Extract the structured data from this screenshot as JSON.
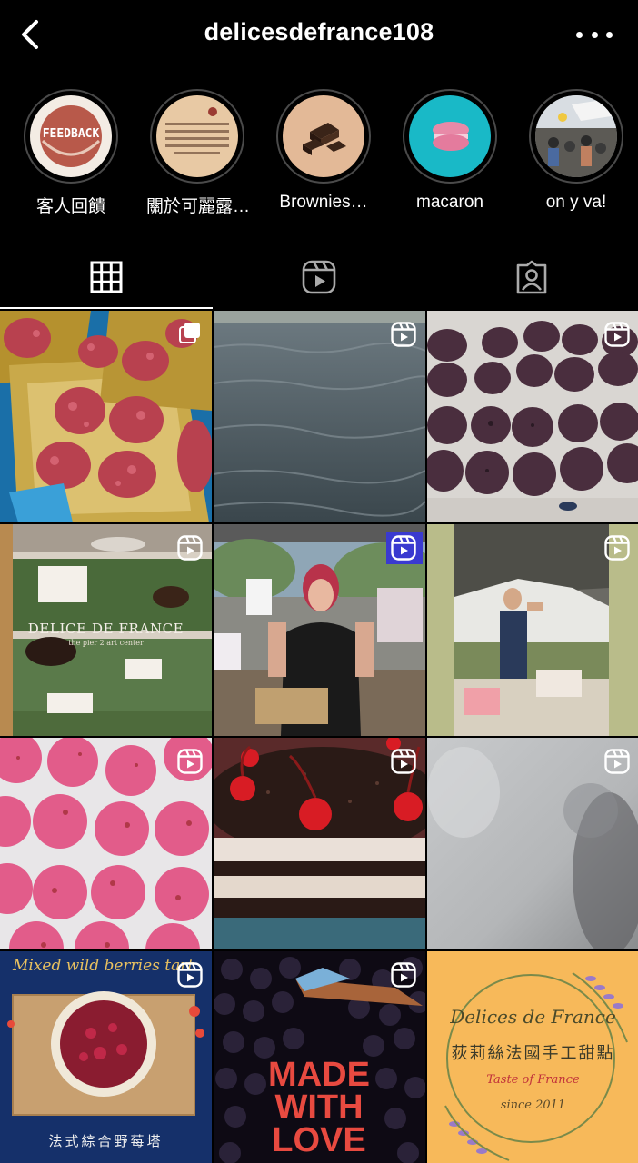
{
  "header": {
    "username": "delicesdefrance108"
  },
  "highlights": [
    {
      "label": "客人回饋",
      "cover_text": "FEEDBACK"
    },
    {
      "label": "關於可麗露…"
    },
    {
      "label": "Brownies…"
    },
    {
      "label": "macaron"
    },
    {
      "label": "on y va!"
    }
  ],
  "tabs": [
    "posts-grid",
    "reels",
    "tagged"
  ],
  "posts": [
    {
      "type": "carousel"
    },
    {
      "type": "reel"
    },
    {
      "type": "reel"
    },
    {
      "type": "reel",
      "overlay_title": "DELICE DE FRANCE",
      "overlay_sub": "the pier 2 art center"
    },
    {
      "type": "reel"
    },
    {
      "type": "reel"
    },
    {
      "type": "reel"
    },
    {
      "type": "reel"
    },
    {
      "type": "reel"
    },
    {
      "type": "reel",
      "overlay_title": "Mixed wild berries tart",
      "overlay_sub": "法式綜合野莓塔"
    },
    {
      "type": "reel",
      "overlay_title": "MADE WITH LOVE"
    },
    {
      "type": "post",
      "overlay_title": "Delices de France",
      "overlay_sub": "荻莉絲法國手工甜點",
      "overlay_tag": "Taste of France",
      "overlay_since": "since 2011"
    }
  ]
}
